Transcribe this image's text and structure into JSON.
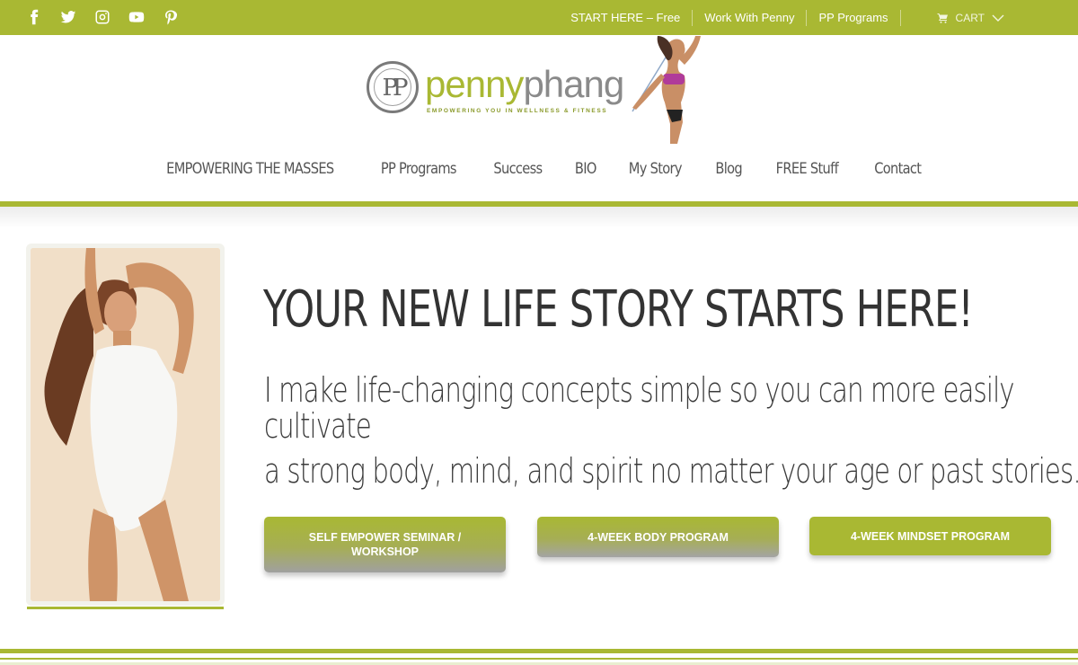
{
  "topbar": {
    "social": [
      {
        "icon": "facebook-icon"
      },
      {
        "icon": "twitter-icon"
      },
      {
        "icon": "instagram-icon"
      },
      {
        "icon": "youtube-icon"
      },
      {
        "icon": "pinterest-icon"
      }
    ],
    "links": [
      "START HERE – Free",
      "Work With Penny",
      "PP Programs"
    ],
    "cart_label": "CART"
  },
  "logo": {
    "word_a": "penny",
    "word_b": "phang",
    "tagline": "EMPOWERING YOU IN WELLNESS & FITNESS",
    "monogram": "PP"
  },
  "nav": {
    "items": [
      "EMPOWERING THE MASSES",
      "PP Programs",
      "Success",
      "BIO",
      "My Story",
      "Blog",
      "FREE Stuff",
      "Contact"
    ]
  },
  "hero": {
    "headline": "YOUR NEW LIFE STORY STARTS HERE!",
    "sub_line1": "I make life-changing concepts simple so you can more easily",
    "sub_line2": "cultivate",
    "sub_line3": "a strong body, mind, and spirit no matter your age or past stories.",
    "buttons": [
      "SELF EMPOWER SEMINAR / WORKSHOP",
      "4-WEEK BODY PROGRAM",
      "4-WEEK MINDSET PROGRAM"
    ]
  },
  "colors": {
    "brand_green": "#a9b833",
    "text_dark": "#333333"
  }
}
